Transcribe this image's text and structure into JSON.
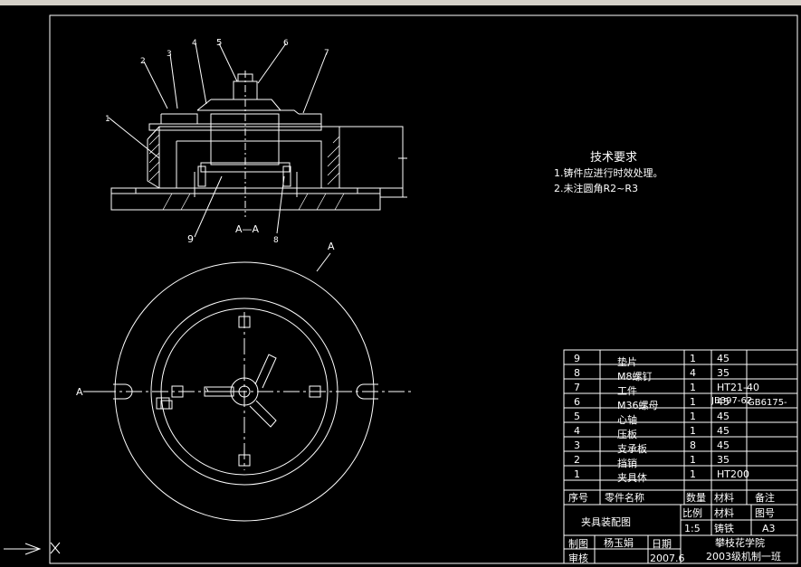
{
  "section_label": "A—A",
  "view_marker": "A",
  "cut_marker_left": "A",
  "balloons": [
    "1",
    "2",
    "3",
    "4",
    "5",
    "6",
    "7",
    "8",
    "9"
  ],
  "tech": {
    "title": "技术要求",
    "line1": "1.铸件应进行时效处理。",
    "line2": "2.未注圆角R2~R3"
  },
  "parts": [
    {
      "no": "9",
      "name": "垫片",
      "qty": "1",
      "mat": "45",
      "note": ""
    },
    {
      "no": "8",
      "name": "M8螺钉",
      "qty": "4",
      "mat": "35",
      "note": ""
    },
    {
      "no": "7",
      "name": "工件",
      "qty": "1",
      "mat": "HT21-40",
      "note": ""
    },
    {
      "no": "6",
      "name": "M36螺母",
      "qty": "1",
      "mat": "45",
      "note": "GB6175-"
    },
    {
      "no": "5",
      "name": "心轴",
      "qty": "1",
      "mat": "45",
      "note": ""
    },
    {
      "no": "4",
      "name": "压板",
      "qty": "1",
      "mat": "45",
      "note": ""
    },
    {
      "no": "3",
      "name": "支承板",
      "qty": "8",
      "mat": "45",
      "note": ""
    },
    {
      "no": "2",
      "name": "挡销",
      "qty": "1",
      "mat": "35",
      "note": ""
    },
    {
      "no": "1",
      "name": "夹具体",
      "qty": "1",
      "mat": "HT200",
      "note": ""
    }
  ],
  "part7_extra": "JB397-62",
  "header": {
    "no": "序号",
    "name": "零件名称",
    "qty": "数量",
    "mat": "材料",
    "note": "备注"
  },
  "title_block": {
    "drawing_name": "夹具装配图",
    "ratio_label": "比例",
    "material_label": "材料",
    "drawing_no_label": "图号",
    "ratio": "1:5",
    "material": "铸铁",
    "size": "A3",
    "drawn_label": "制图",
    "drawer": "杨玉娟",
    "date_label": "日期",
    "date": "2007.6",
    "check_label": "审核",
    "school": "攀枝花学院",
    "class": "2003级机制一班"
  }
}
